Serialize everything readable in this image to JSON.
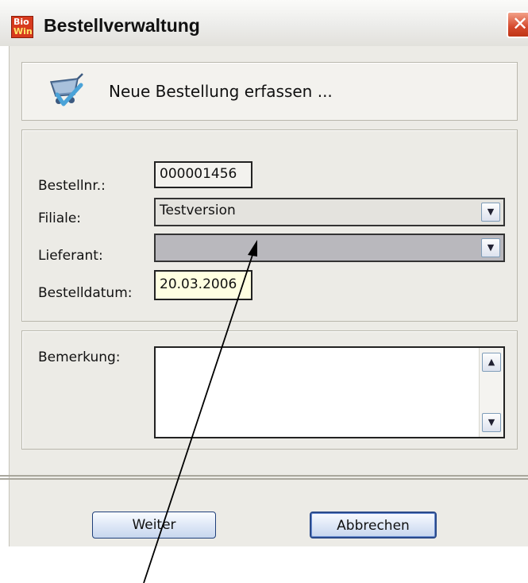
{
  "window": {
    "title": "Bestellverwaltung",
    "app_icon_line1": "Bio",
    "app_icon_line2": "Win",
    "close_symbol": "✕",
    "accent_close": "#d5492c"
  },
  "header": {
    "icon": "cart-check-icon",
    "text": "Neue Bestellung erfassen ..."
  },
  "form": {
    "order_no_label": "Bestellnr.:",
    "order_no_value": "000001456",
    "branch_label": "Filiale:",
    "branch_value": "Testversion",
    "supplier_label": "Lieferant:",
    "supplier_value": "",
    "date_label": "Bestelldatum:",
    "date_value": "20.03.2006"
  },
  "remark": {
    "label": "Bemerkung:",
    "value": ""
  },
  "buttons": {
    "next_label": "Weiter",
    "cancel_label": "Abbrechen"
  },
  "dropdown_glyph": "▼",
  "scroll_up_glyph": "▲",
  "scroll_down_glyph": "▼"
}
